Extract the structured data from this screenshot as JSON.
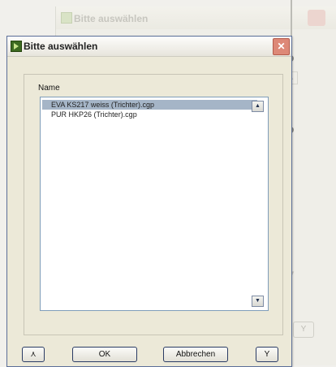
{
  "background_window": {
    "title": "Bitte auswählen",
    "scroll_up_glyph": "▲",
    "scroll_down_glyph": "▼",
    "button_glyph": "Y"
  },
  "dialog": {
    "title": "Bitte auswählen",
    "close_glyph": "✕"
  },
  "list": {
    "header": "Name",
    "items": [
      {
        "label": "EVA KS217 weiss (Trichter).cgp",
        "selected": true
      },
      {
        "label": "PUR HKP26 (Trichter).cgp",
        "selected": false
      }
    ],
    "scroll_up_glyph": "▲",
    "scroll_down_glyph": "▼"
  },
  "buttons": {
    "left_glyph": "⋏",
    "ok": "OK",
    "cancel": "Abbrechen",
    "right_glyph": "Y"
  }
}
